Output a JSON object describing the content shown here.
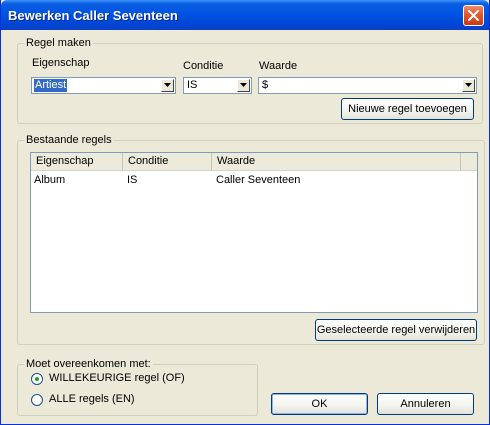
{
  "window": {
    "title": "Bewerken Caller Seventeen"
  },
  "make_rule": {
    "legend": "Regel maken",
    "property_label": "Eigenschap",
    "property_value": "Artiest",
    "condition_label": "Conditie",
    "condition_value": "IS",
    "value_label": "Waarde",
    "value_value": "$",
    "add_button": "Nieuwe regel toevoegen"
  },
  "existing_rules": {
    "legend": "Bestaande regels",
    "columns": [
      "Eigenschap",
      "Conditie",
      "Waarde"
    ],
    "rows": [
      {
        "property": "Album",
        "condition": "IS",
        "value": "Caller Seventeen"
      }
    ],
    "remove_button": "Geselecteerde regel verwijderen"
  },
  "match": {
    "legend": "Moet overeenkomen met:",
    "options": [
      {
        "label": "WILLEKEURIGE regel (OF)",
        "checked": true
      },
      {
        "label": "ALLE regels (EN)",
        "checked": false
      }
    ]
  },
  "buttons": {
    "ok": "OK",
    "cancel": "Annuleren"
  }
}
